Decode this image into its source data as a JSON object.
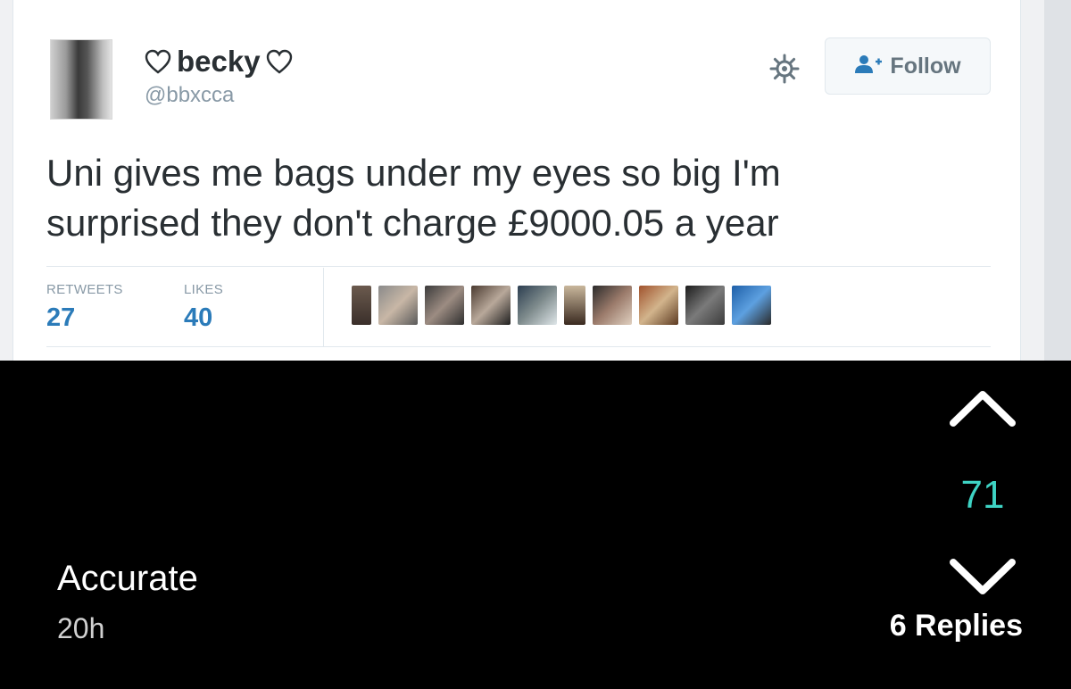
{
  "tweet": {
    "display_name": "becky",
    "handle": "@bbxcca",
    "follow_label": "Follow",
    "text_line1": "Uni gives me bags under my eyes so big I'm",
    "text_line2": "surprised they don't charge £9000.05 a year",
    "retweets_label": "RETWEETS",
    "retweets_count": "27",
    "likes_label": "LIKES",
    "likes_count": "40",
    "liker_avatar_count": 10
  },
  "post": {
    "caption": "Accurate",
    "time": "20h",
    "score": "71",
    "replies": "6 Replies"
  },
  "colors": {
    "accent_blue": "#2b7bb9",
    "score_teal": "#3ed3c4"
  },
  "icons": [
    "heart-outline-icon",
    "gear-icon",
    "add-user-icon",
    "chevron-up-icon",
    "chevron-down-icon"
  ]
}
